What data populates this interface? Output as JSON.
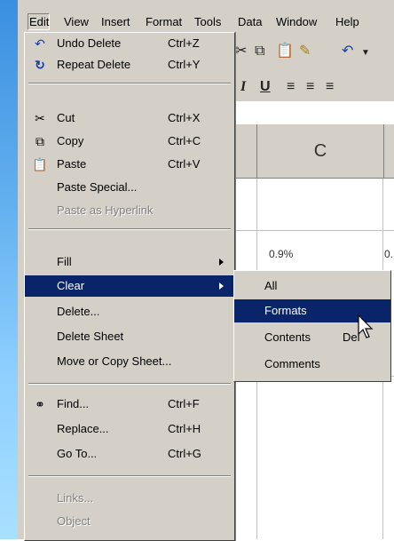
{
  "menubar": {
    "items": [
      "Edit",
      "View",
      "Insert",
      "Format",
      "Tools",
      "Data",
      "Window",
      "Help"
    ]
  },
  "column_header": "C",
  "cell_fragments": [
    "0.9%",
    "0."
  ],
  "edit_menu": {
    "undo": {
      "label": "Undo Delete",
      "shortcut": "Ctrl+Z",
      "icon": "undo-icon"
    },
    "repeat": {
      "label": "Repeat Delete",
      "shortcut": "Ctrl+Y",
      "icon": "redo-icon"
    },
    "cut": {
      "label": "Cut",
      "shortcut": "Ctrl+X",
      "icon": "scissors-icon"
    },
    "copy": {
      "label": "Copy",
      "shortcut": "Ctrl+C",
      "icon": "copy-icon"
    },
    "paste": {
      "label": "Paste",
      "shortcut": "Ctrl+V",
      "icon": "paste-icon"
    },
    "paste_special": {
      "label": "Paste Special..."
    },
    "paste_hyperlink": {
      "label": "Paste as Hyperlink"
    },
    "fill": {
      "label": "Fill"
    },
    "clear": {
      "label": "Clear"
    },
    "delete": {
      "label": "Delete..."
    },
    "delete_sheet": {
      "label": "Delete Sheet"
    },
    "move_copy": {
      "label": "Move or Copy Sheet..."
    },
    "find": {
      "label": "Find...",
      "shortcut": "Ctrl+F",
      "icon": "binoculars-icon"
    },
    "replace": {
      "label": "Replace...",
      "shortcut": "Ctrl+H"
    },
    "goto": {
      "label": "Go To...",
      "shortcut": "Ctrl+G"
    },
    "links": {
      "label": "Links..."
    },
    "object": {
      "label": "Object"
    }
  },
  "clear_submenu": {
    "all": {
      "label": "All"
    },
    "formats": {
      "label": "Formats"
    },
    "contents": {
      "label": "Contents",
      "shortcut": "Del"
    },
    "comments": {
      "label": "Comments"
    }
  },
  "colors": {
    "highlight": "#0a246a",
    "face": "#d4d0c8",
    "desktop": "#66b2f0"
  }
}
